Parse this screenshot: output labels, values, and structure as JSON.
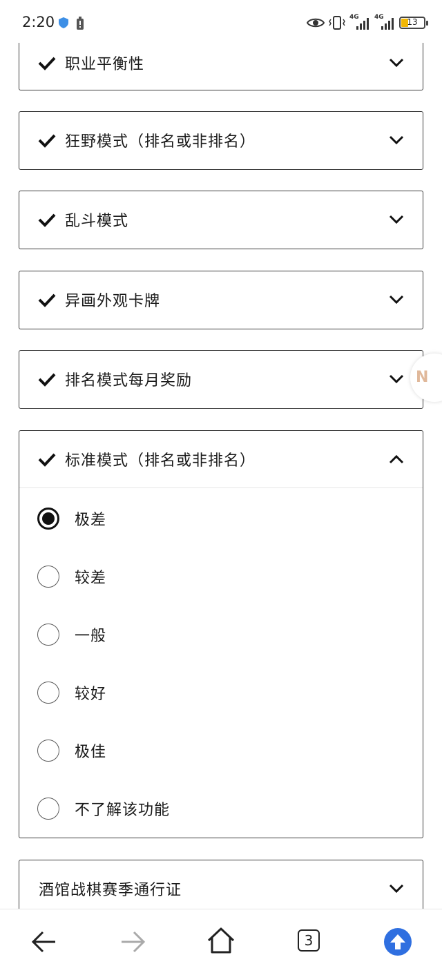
{
  "status_bar": {
    "time": "2:20",
    "battery_level": "13",
    "network_label_1": "4G",
    "network_label_2": "4G"
  },
  "accordion": {
    "items": [
      {
        "title": "职业平衡性",
        "checked": true,
        "expanded": false
      },
      {
        "title": "狂野模式（排名或非排名）",
        "checked": true,
        "expanded": false
      },
      {
        "title": "乱斗模式",
        "checked": true,
        "expanded": false
      },
      {
        "title": "异画外观卡牌",
        "checked": true,
        "expanded": false
      },
      {
        "title": "排名模式每月奖励",
        "checked": true,
        "expanded": false
      },
      {
        "title": "标准模式（排名或非排名）",
        "checked": true,
        "expanded": true
      },
      {
        "title": "酒馆战棋赛季通行证",
        "checked": false,
        "expanded": false
      }
    ],
    "expanded_options": [
      {
        "label": "极差",
        "selected": true
      },
      {
        "label": "较差",
        "selected": false
      },
      {
        "label": "一般",
        "selected": false
      },
      {
        "label": "较好",
        "selected": false
      },
      {
        "label": "极佳",
        "selected": false
      },
      {
        "label": "不了解该功能",
        "selected": false
      }
    ]
  },
  "float_badge": {
    "text": "N"
  },
  "bottom_nav": {
    "tab_count": "3",
    "icons": [
      "back-arrow-icon",
      "forward-arrow-icon",
      "home-icon",
      "tabs-icon",
      "scroll-up-icon"
    ]
  },
  "colors": {
    "accent_blue": "#2f6fe0",
    "border": "#3a3a3a",
    "text": "#1a1a1a"
  }
}
